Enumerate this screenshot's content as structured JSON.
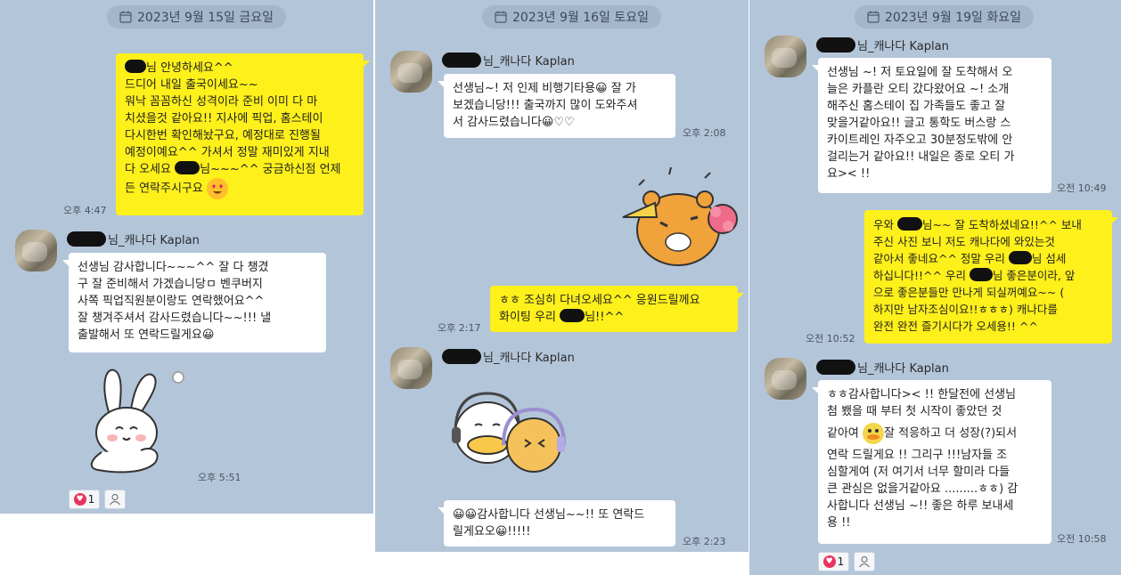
{
  "colors": {
    "chat_bg": "#b3c5d9",
    "my_bubble": "#fef01b",
    "their_bubble": "#ffffff",
    "date_pill": "#a4b6ca",
    "reaction_heart": "#e8335e"
  },
  "panel1": {
    "date": "2023년 9월 15일 금요일",
    "msg1": {
      "lines": [
        "님 안녕하세요^^",
        "드디어 내일 출국이세요~~",
        "워낙 꼼꼼하신 성격이라 준비 이미 다 마",
        "치셨을것 같아요!! 지사에 픽업, 홈스테이",
        "다시한번 확인해놨구요, 예정대로 진행될",
        "예정이예요^^ 가셔서 정말 재미있게 지내",
        "다 오세요 ",
        "님~~~^^ 궁금하신점 언제",
        "든 연락주시구요"
      ],
      "emoji": "heart-eyes-emoji",
      "time": "오후 4:47"
    },
    "sender": "님_캐나다 Kaplan",
    "msg2": {
      "lines": [
        "선생님 감사합니다~~~^^ 잘 다 챙겼",
        "구 잘 준비해서 가겠습니당ㅁ 벤쿠버지",
        "사쪽 픽업직원분이랑도 연락했어요^^",
        "잘 챙겨주셔서 감사드렸습니다~~!!! 낼",
        "출발해서 또 연락드릴게요😀"
      ]
    },
    "sticker": "white-rabbit-sticker",
    "sticker_time": "오후 5:51",
    "reaction_count": "1"
  },
  "panel2": {
    "date": "2023년 9월 16일 토요일",
    "sender": "님_캐나다 Kaplan",
    "msg1": {
      "lines": [
        "선생님~! 저 인제 비행기타용😀 잘 가",
        "보겠습니당!!! 출국까지 많이 도와주셔",
        "서 감사드렸습니다😀♡♡"
      ],
      "time": "오후 2:08"
    },
    "sticker1": "ryan-cheering-sticker",
    "msg2": {
      "lines": [
        "ㅎㅎ 조심히 다녀오세요^^ 응원드릴께요",
        "화이팅 우리 ",
        "님!!^^"
      ],
      "time": "오후 2:17"
    },
    "sender2": "님_캐나다 Kaplan",
    "sticker2": "duck-and-cat-headphones-sticker",
    "msg3": {
      "lines": [
        "😀😀감사합니다 선생님~~!! 또 연락드",
        "릴게요오😀!!!!!"
      ],
      "time": "오후 2:23"
    }
  },
  "panel3": {
    "date": "2023년 9월 19일 화요일",
    "sender": "님_캐나다 Kaplan",
    "msg1": {
      "lines": [
        "선생님 ~! 저 토요일에 잘 도착해서 오",
        "늘은 카플란 오티 갔다왔어요 ~! 소개",
        "해주신 홈스테이 집 가족들도 좋고 잘",
        "맞을거같아요!! 글고 통학도 버스랑 스",
        "카이트레인 자주오고 30분정도밖에 안",
        "걸리는거 같아요!! 내일은 종로 오티 가",
        "요>< !!"
      ],
      "time": "오전 10:49"
    },
    "msg2": {
      "lines": [
        "우와 ",
        "님~~ 잘 도착하셨네요!!^^ 보내",
        "주신 사진 보니 저도 캐나다에 와있는것",
        "같아서 좋네요^^ 정말 우리 ",
        "님 섬세",
        "하십니다!!^^ 우리 ",
        "님 좋은분이라, 앞",
        "으로 좋은분들만 만나게 되실꺼예요~~ (",
        "하지만 남자조심이요!!ㅎㅎㅎ) 캐나다를",
        "완전 완전 즐기시다가 오세용!! ^^"
      ],
      "time": "오전 10:52"
    },
    "sender2": "님_캐나다 Kaplan",
    "msg3": {
      "lines": [
        "ㅎㅎ감사합니다>< !! 한달전에 선생님",
        "첨 뵀을 때 부터 첫 시작이 좋았던 것",
        "같아여",
        "잘 적응하고 더 성장(?)되서",
        "연락 드릴게요 !! 그리구 !!!남자들 조",
        "심할게여 (저 여기서 너무 할미라 다들",
        "큰 관심은 없을거같아요 .........ㅎㅎ) 감",
        "사합니다 선생님 ~!! 좋은 하루 보내세",
        "용 !!"
      ],
      "emoji": "duck-emoji",
      "time": "오전 10:58"
    },
    "reaction_count": "1"
  }
}
